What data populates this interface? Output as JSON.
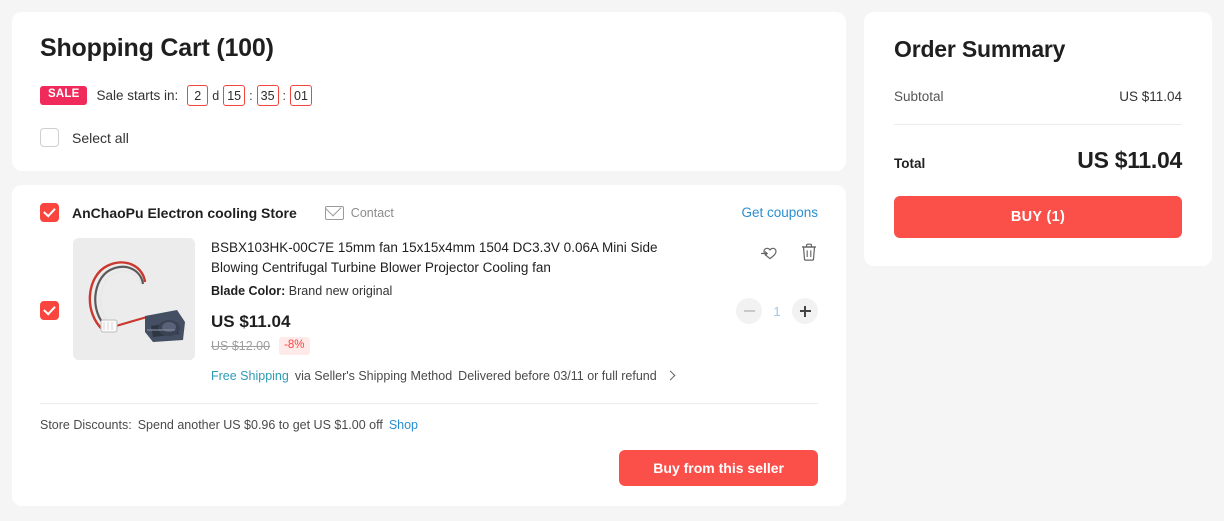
{
  "cart": {
    "title": "Shopping Cart (100)",
    "sale_badge": "SALE",
    "sale_label": "Sale starts in:",
    "timer": {
      "days": "2",
      "day_unit": "d",
      "hours": "15",
      "sep1": ":",
      "minutes": "35",
      "sep2": ":",
      "seconds": "01"
    },
    "select_all_label": "Select all"
  },
  "store": {
    "name": "AnChaoPu Electron cooling Store",
    "contact_label": "Contact",
    "coupons_label": "Get coupons",
    "discount_label": "Store Discounts:",
    "discount_text": "Spend another US $0.96 to get US $1.00 off",
    "shop_link": "Shop",
    "seller_buy_label": "Buy from this seller"
  },
  "item": {
    "title": "BSBX103HK-00C7E 15mm fan 15x15x4mm 1504 DC3.3V 0.06A Mini Side Blowing Centrifugal Turbine Blower Projector Cooling fan",
    "attr_label": "Blade Color:",
    "attr_value": "Brand new original",
    "price": "US $11.04",
    "price_original": "US $12.00",
    "discount_badge": "-8%",
    "shipping_free": "Free Shipping",
    "shipping_method": "via Seller's Shipping Method",
    "shipping_delivery": "Delivered before 03/11 or full refund",
    "quantity": "1",
    "minus_label": "−",
    "plus_label": "+"
  },
  "summary": {
    "title": "Order Summary",
    "subtotal_label": "Subtotal",
    "subtotal_value": "US $11.04",
    "total_label": "Total",
    "total_value": "US $11.04",
    "buy_label": "BUY (1)"
  },
  "colors": {
    "accent_red": "#fb4f4a",
    "sale_pink": "#f02b5b",
    "link_blue": "#2a8fd0",
    "shipping_teal": "#2e9bb5",
    "page_bg": "#f5f5f5"
  }
}
